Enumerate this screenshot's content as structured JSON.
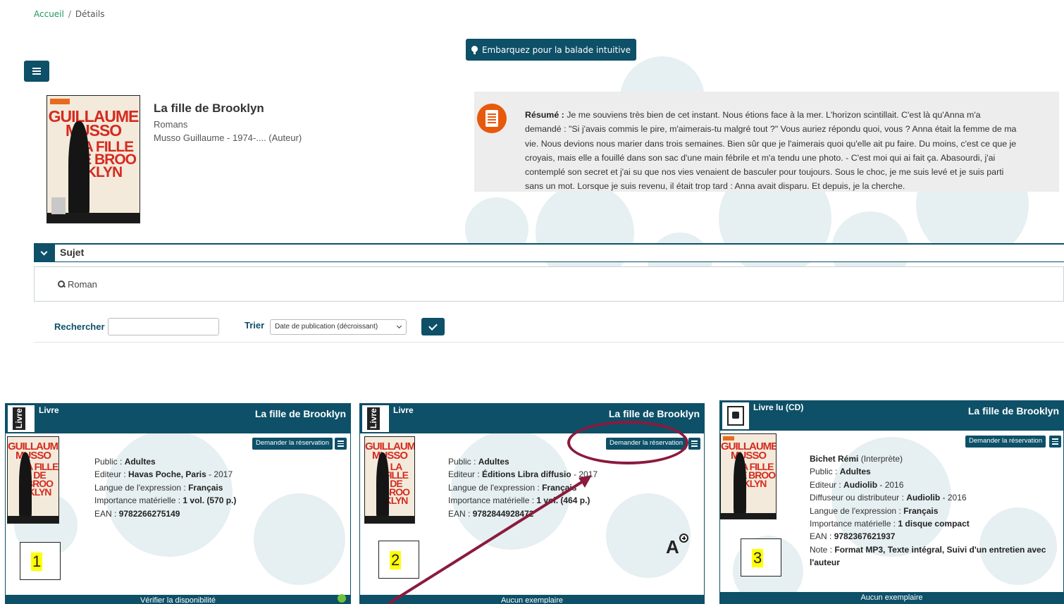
{
  "breadcrumb": {
    "home": "Accueil",
    "separator": "/",
    "current": "Détails"
  },
  "tour_button": {
    "label": "Embarquez pour la balade intuitive"
  },
  "book": {
    "title": "La fille de Brooklyn",
    "genre": "Romans",
    "author": "Musso Guillaume - 1974-.... (Auteur)",
    "cover": {
      "author_text": "GUILLAUME MUSSO",
      "title_text": "LA FILLE DE BROO KLYN"
    }
  },
  "summary": {
    "label": "Résumé :",
    "text": "Je me souviens très bien de cet instant. Nous étions face à la mer. L'horizon scintillait. C'est là qu'Anna m'a demandé : \"Si j'avais commis le pire, m'aimerais-tu malgré tout ?\" Vous auriez répondu quoi, vous ? Anna était la femme de ma vie. Nous devions nous marier dans trois semaines. Bien sûr que je l'aimerais quoi qu'elle ait pu faire. Du moins, c'est ce que je croyais, mais elle a fouillé dans son sac d'une main fébrile et m'a tendu une photo. - C'est moi qui ai fait ça. Abasourdi, j'ai contemplé son secret et j'ai su que nos vies venaient de basculer pour toujours. Sous le choc, je me suis levé et je suis parti sans un mot. Lorsque je suis revenu, il était trop tard : Anna avait disparu. Et depuis, je la cherche.",
    "icon": "document-icon"
  },
  "subject": {
    "label": "Sujet",
    "link": "Roman"
  },
  "search": {
    "search_label": "Rechercher",
    "search_value": "",
    "sort_label": "Trier",
    "sort_value": "Date de publication (décroissant)"
  },
  "colors": {
    "primary": "#0d5068",
    "accent": "#e8590c",
    "annotation": "#8b1a3d",
    "highlight": "#ffff00",
    "available": "#6fc33a"
  },
  "cards": [
    {
      "type_label": "Livre",
      "type_icon_text": "Livre",
      "title": "La fille de Brooklyn",
      "reserve_label": "Demander la réservation",
      "lines": [
        {
          "k": "Public : ",
          "v": "Adultes",
          "r": ""
        },
        {
          "k": "Editeur : ",
          "v": "Havas Poche, Paris",
          "r": " - 2017"
        },
        {
          "k": "Langue de l'expression : ",
          "v": "Français",
          "r": ""
        },
        {
          "k": "Importance matérielle : ",
          "v": "1 vol. (570 p.)",
          "r": ""
        },
        {
          "k": "EAN : ",
          "v": "9782266275149",
          "r": ""
        }
      ],
      "number": "1",
      "footer": "Vérifier la disponibilité"
    },
    {
      "type_label": "Livre",
      "type_icon_text": "Livre",
      "title": "La fille de Brooklyn",
      "reserve_label": "Demander la réservation",
      "lines": [
        {
          "k": "Public : ",
          "v": "Adultes",
          "r": ""
        },
        {
          "k": "Editeur : ",
          "v": "Éditions Libra diffusio",
          "r": " - 2017"
        },
        {
          "k": "Langue de l'expression : ",
          "v": "Français",
          "r": ""
        },
        {
          "k": "Importance matérielle : ",
          "v": "1 vol. (464 p.)",
          "r": ""
        },
        {
          "k": "EAN : ",
          "v": "9782844928472",
          "r": ""
        }
      ],
      "number": "2",
      "zoom_glyph": "A",
      "footer": "Aucun exemplaire"
    },
    {
      "type_label": "Livre lu (CD)",
      "title": "La fille de Brooklyn",
      "reserve_label": "Demander la réservation",
      "lines": [
        {
          "k": "",
          "v": "Bichet Rémi",
          "r": " (Interprète)"
        },
        {
          "k": "Public : ",
          "v": "Adultes",
          "r": ""
        },
        {
          "k": "Editeur : ",
          "v": "Audiolib",
          "r": " - 2016"
        },
        {
          "k": "Diffuseur ou distributeur : ",
          "v": "Audiolib",
          "r": " - 2016"
        },
        {
          "k": "Langue de l'expression : ",
          "v": "Français",
          "r": ""
        },
        {
          "k": "Importance matérielle : ",
          "v": "1 disque compact",
          "r": ""
        },
        {
          "k": "EAN : ",
          "v": "9782367621937",
          "r": ""
        },
        {
          "k": "Note : ",
          "v": "Format MP3,  Texte intégral,  Suivi d'un entretien avec l'auteur",
          "r": ""
        }
      ],
      "number": "3",
      "footer": "Aucun exemplaire"
    }
  ]
}
